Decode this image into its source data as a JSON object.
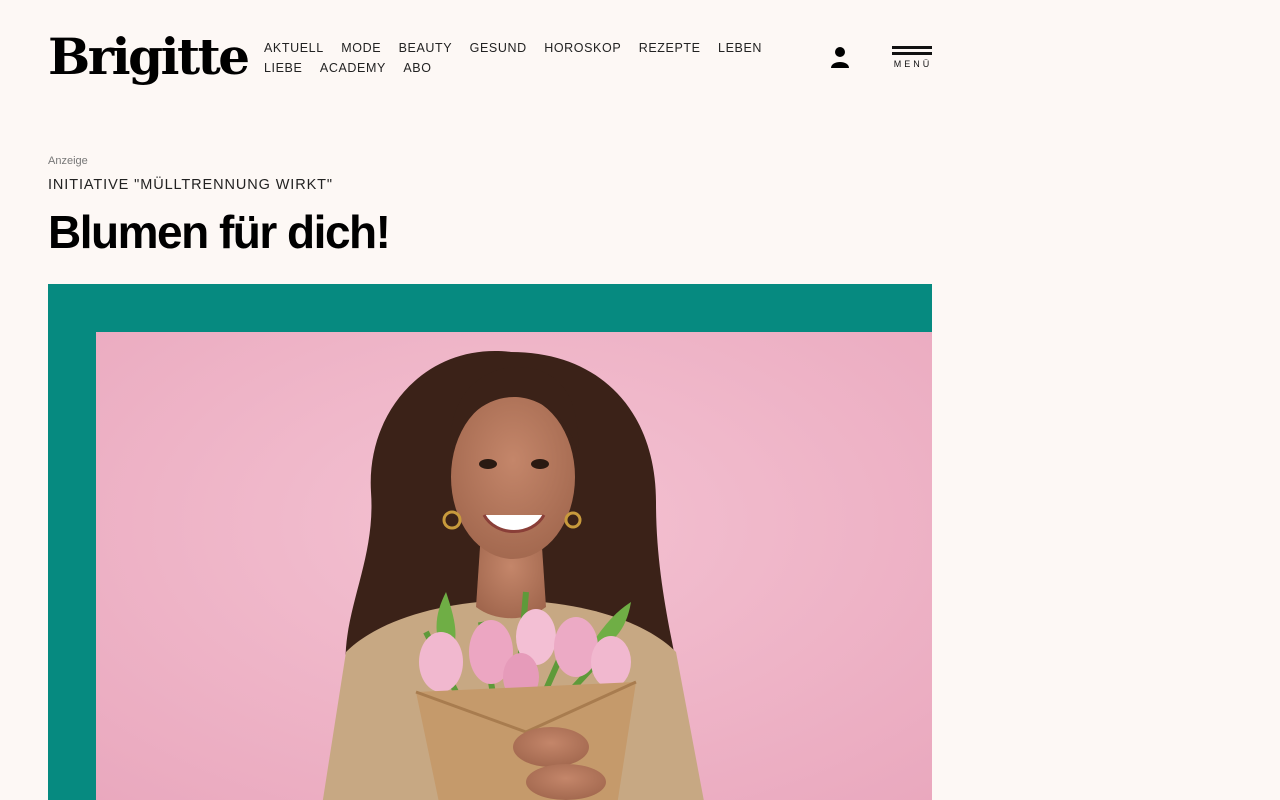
{
  "brand": {
    "logo_text": "Brigitte"
  },
  "nav": {
    "items": [
      "AKTUELL",
      "MODE",
      "BEAUTY",
      "GESUND",
      "HOROSKOP",
      "REZEPTE",
      "LEBEN",
      "LIEBE",
      "ACADEMY",
      "ABO"
    ]
  },
  "header": {
    "menu_label": "MENÜ",
    "user_icon": "user-icon",
    "menu_icon": "hamburger-icon"
  },
  "article": {
    "ad_label": "Anzeige",
    "kicker": "INITIATIVE \"MÜLLTRENNUNG WIRKT\"",
    "headline": "Blumen für dich!"
  },
  "colors": {
    "background": "#fdf8f5",
    "hero_frame": "#068a80",
    "photo_background": "#f0b4c8",
    "text": "#111111"
  }
}
